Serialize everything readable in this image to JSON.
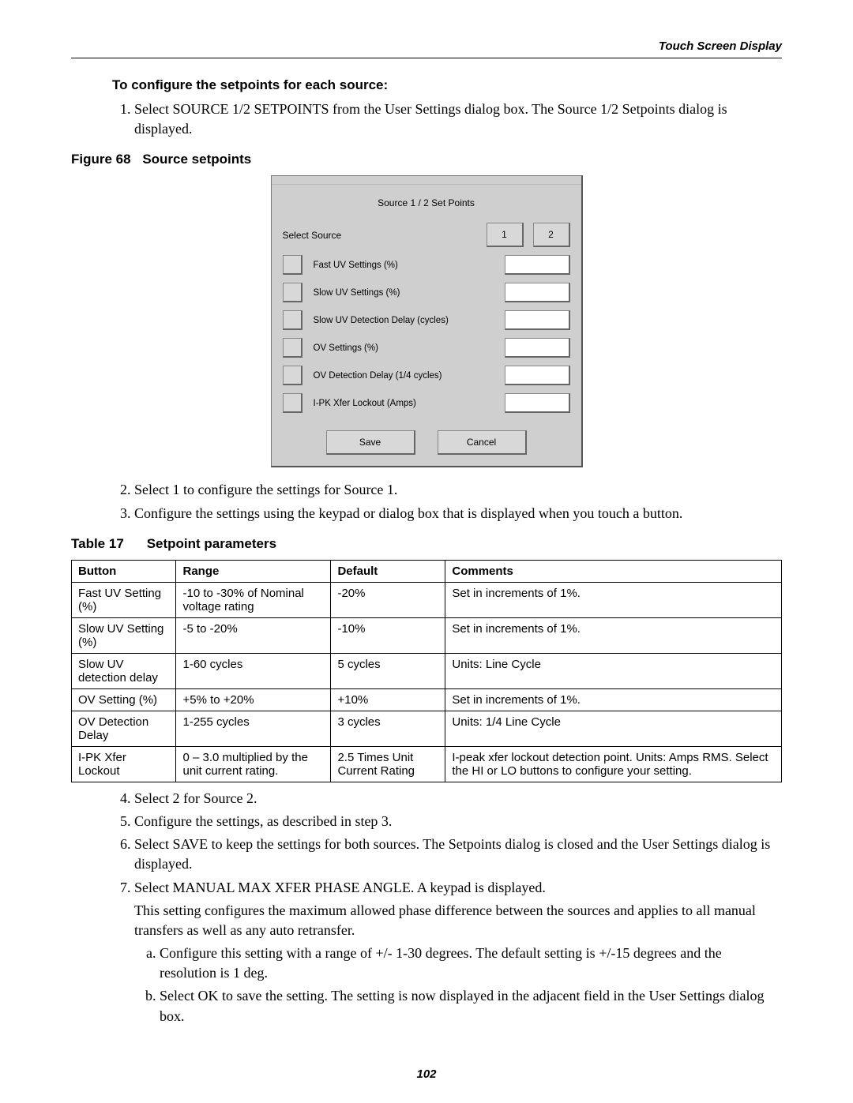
{
  "header": {
    "right": "Touch Screen Display"
  },
  "headings": {
    "configure": "To configure the setpoints for each source:"
  },
  "list1": {
    "item1": "Select SOURCE 1/2 SETPOINTS from the User Settings dialog box. The Source 1/2 Setpoints dialog is displayed."
  },
  "figure": {
    "number": "Figure 68",
    "title": "Source setpoints"
  },
  "dialog": {
    "title": "Source 1 / 2 Set Points",
    "select_source": "Select Source",
    "src1": "1",
    "src2": "2",
    "fields": [
      "Fast UV Settings (%)",
      "Slow UV Settings (%)",
      "Slow UV Detection Delay (cycles)",
      "OV Settings (%)",
      "OV Detection Delay (1/4 cycles)",
      "I-PK Xfer Lockout (Amps)"
    ],
    "save": "Save",
    "cancel": "Cancel"
  },
  "list2": {
    "item2": "Select 1 to configure the settings for Source 1.",
    "item3": "Configure the settings using the keypad or dialog box that is displayed when you touch a button."
  },
  "table": {
    "number": "Table 17",
    "title": "Setpoint parameters",
    "headers": [
      "Button",
      "Range",
      "Default",
      "Comments"
    ],
    "rows": [
      [
        "Fast UV Setting (%)",
        "-10 to -30% of Nominal voltage rating",
        "-20%",
        "Set in increments of 1%."
      ],
      [
        "Slow UV Setting (%)",
        "-5 to -20%",
        "-10%",
        "Set in increments of 1%."
      ],
      [
        "Slow UV detection delay",
        "1-60 cycles",
        "5 cycles",
        "Units: Line Cycle"
      ],
      [
        "OV Setting (%)",
        "+5% to +20%",
        "+10%",
        "Set in increments of 1%."
      ],
      [
        "OV Detection Delay",
        "1-255 cycles",
        "3 cycles",
        "Units: 1/4 Line Cycle"
      ],
      [
        "I-PK Xfer Lockout",
        "0 – 3.0 multiplied by the unit current rating.",
        "2.5 Times Unit Current Rating",
        "I-peak xfer lockout detection point. Units: Amps RMS. Select the HI or LO buttons to configure your setting."
      ]
    ]
  },
  "list3": {
    "item4": "Select 2 for Source 2.",
    "item5": "Configure the settings, as described in step 3.",
    "item6": "Select SAVE to keep the settings for both sources. The Setpoints dialog is closed and the User Settings dialog is displayed.",
    "item7": "Select MANUAL MAX XFER PHASE ANGLE. A keypad is displayed.",
    "item7_p": "This setting configures the maximum allowed phase difference between the sources and applies to all manual transfers as well as any auto retransfer.",
    "item7_a": "Configure this setting with a range of +/- 1-30 degrees. The default setting is +/-15 degrees and the resolution is 1 deg.",
    "item7_b": "Select OK to save the setting. The setting is now displayed in the adjacent field in the User Settings dialog box."
  },
  "page_number": "102"
}
